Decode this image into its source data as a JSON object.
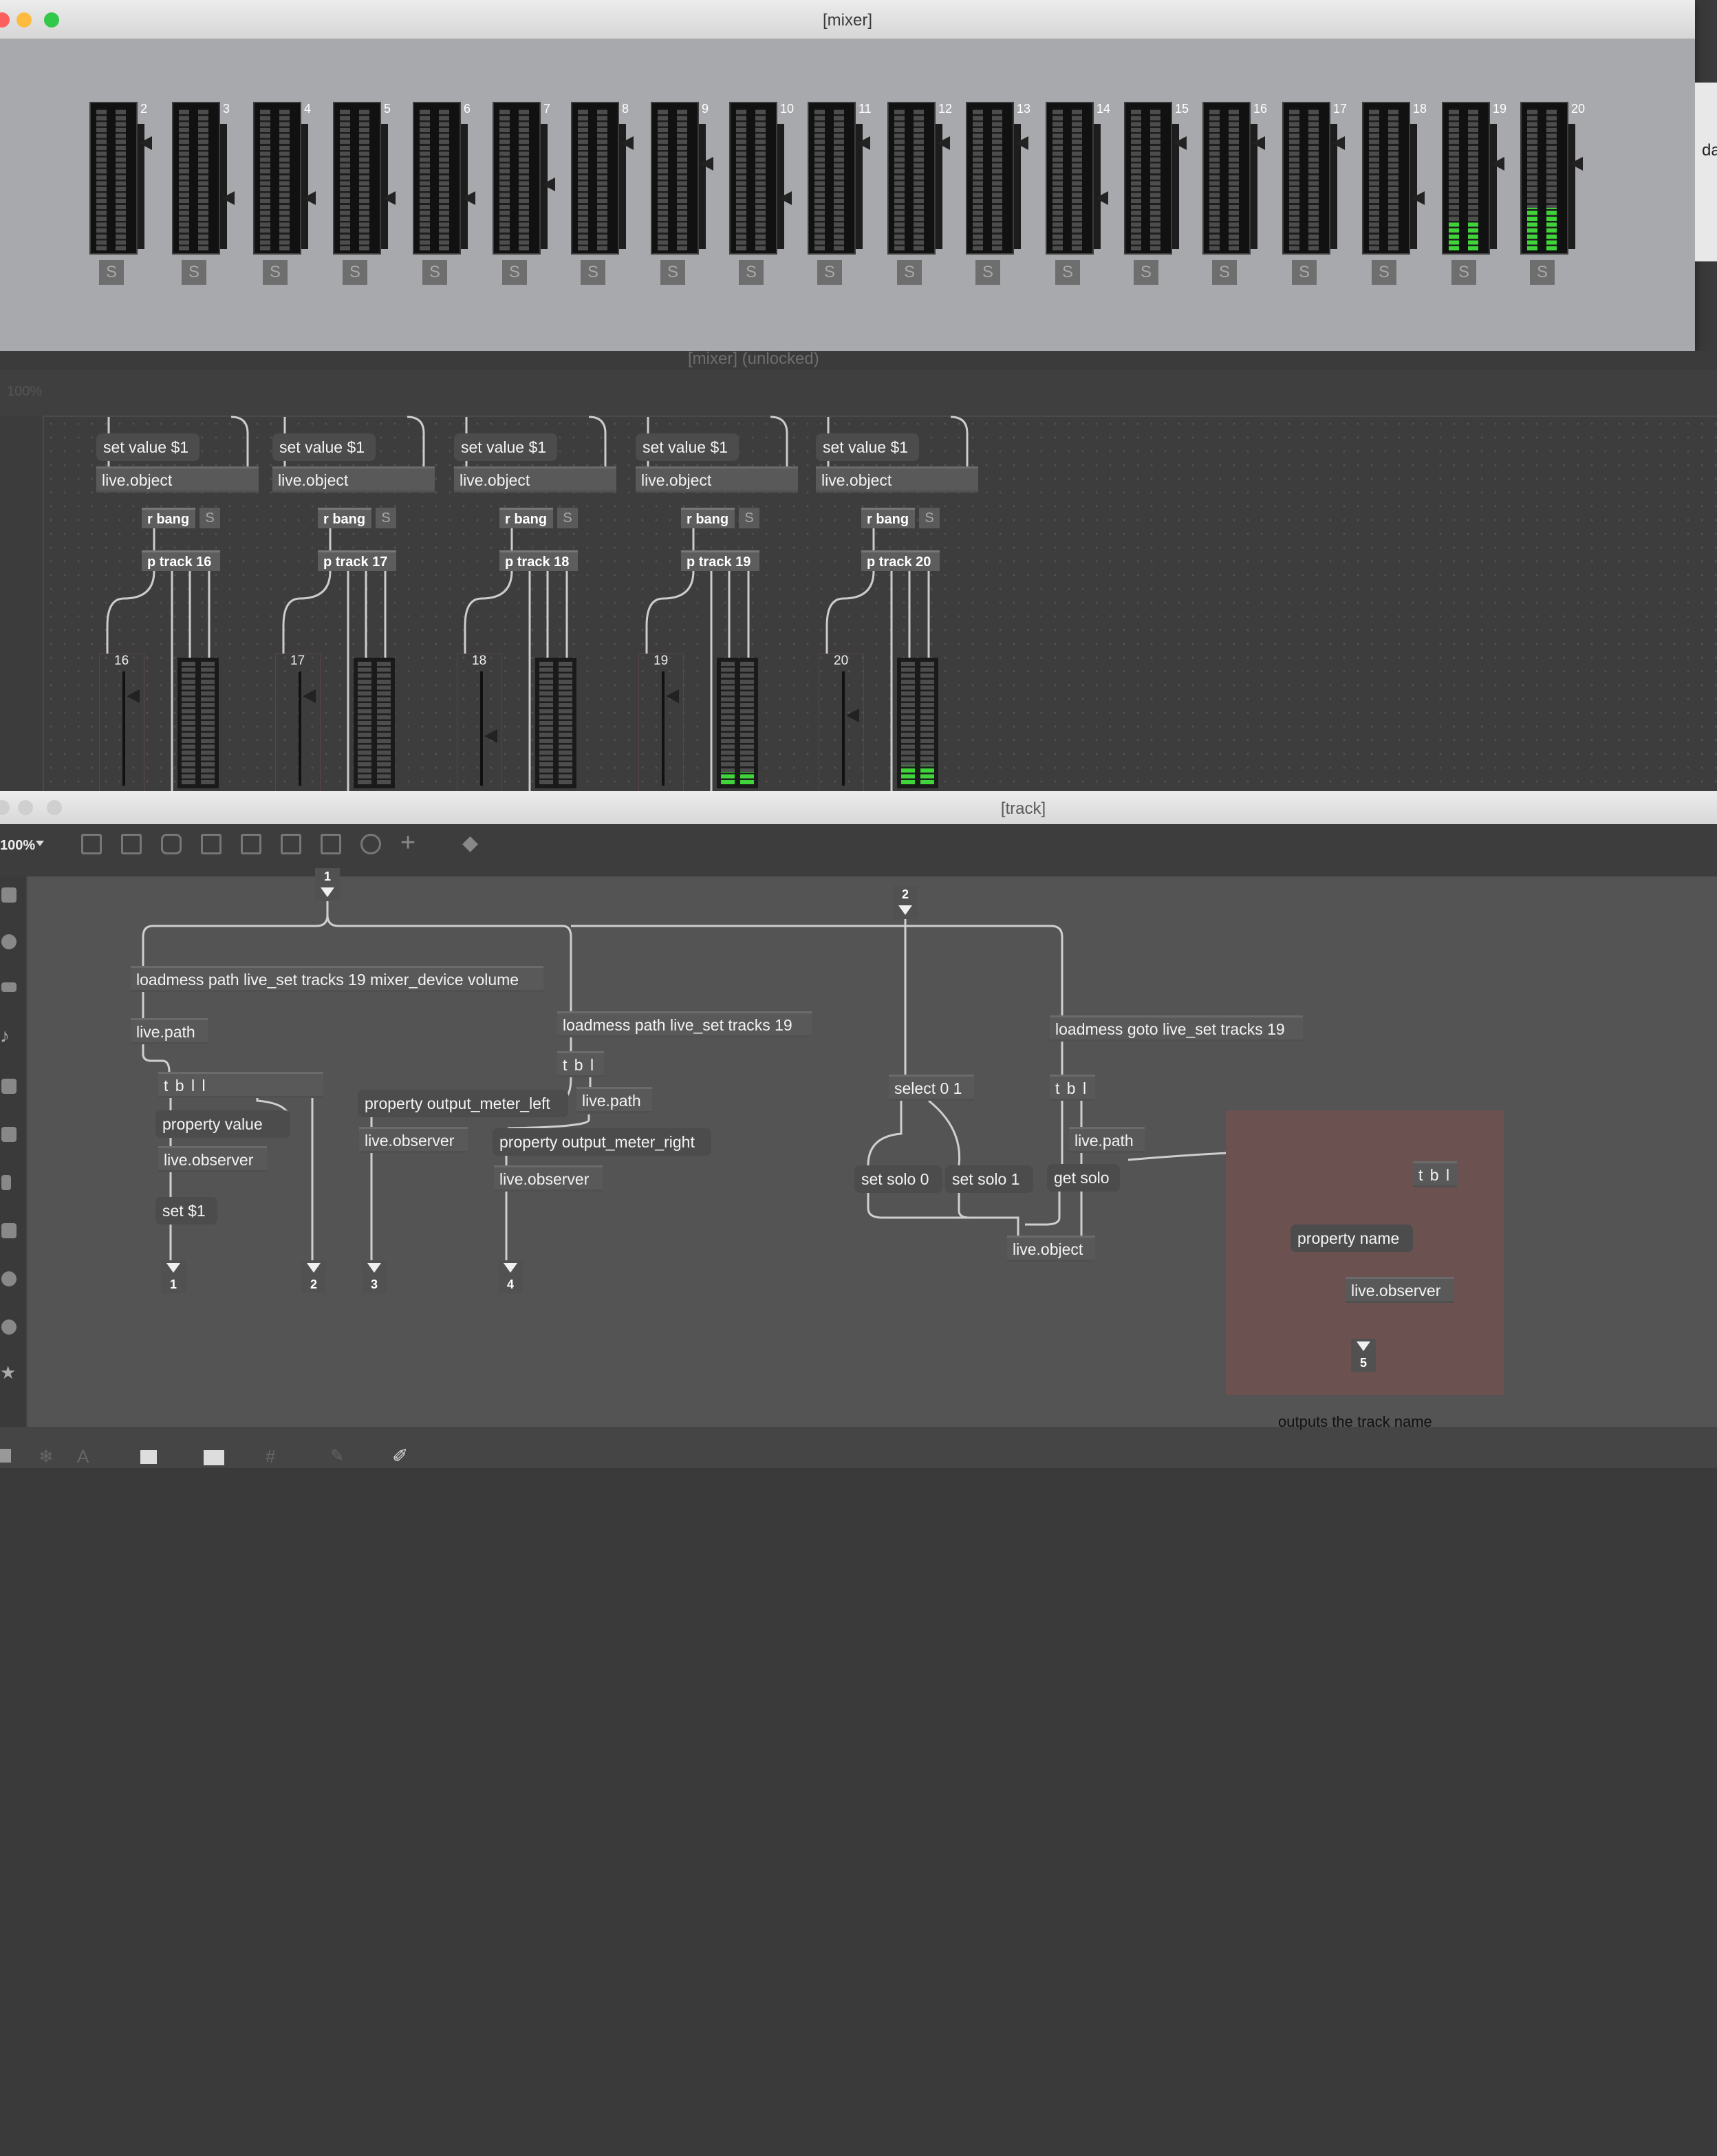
{
  "mixer_window": {
    "title": "[mixer]",
    "channels": [
      {
        "num": "2",
        "solo": "S",
        "left": 0,
        "right": 0
      },
      {
        "num": "3",
        "solo": "S",
        "left": 0,
        "right": 0
      },
      {
        "num": "4",
        "solo": "S",
        "left": 0,
        "right": 0
      },
      {
        "num": "5",
        "solo": "S",
        "left": 0,
        "right": 0
      },
      {
        "num": "6",
        "solo": "S",
        "left": 0,
        "right": 0
      },
      {
        "num": "7",
        "solo": "S",
        "left": 0,
        "right": 0
      },
      {
        "num": "8",
        "solo": "S",
        "left": 0,
        "right": 0
      },
      {
        "num": "9",
        "solo": "S",
        "left": 0,
        "right": 0
      },
      {
        "num": "10",
        "solo": "S",
        "left": 0,
        "right": 0
      },
      {
        "num": "11",
        "solo": "S",
        "left": 0,
        "right": 0
      },
      {
        "num": "12",
        "solo": "S",
        "left": 0,
        "right": 0
      },
      {
        "num": "13",
        "solo": "S",
        "left": 0,
        "right": 0
      },
      {
        "num": "14",
        "solo": "S",
        "left": 0,
        "right": 0
      },
      {
        "num": "15",
        "solo": "S",
        "left": 0,
        "right": 0
      },
      {
        "num": "16",
        "solo": "S",
        "left": 0,
        "right": 0
      },
      {
        "num": "17",
        "solo": "S",
        "left": 0,
        "right": 0
      },
      {
        "num": "18",
        "solo": "S",
        "left": 0,
        "right": 0
      },
      {
        "num": "19",
        "solo": "S",
        "left": 0.2,
        "right": 0.2
      },
      {
        "num": "20",
        "solo": "S",
        "left": 0.3,
        "right": 0.3
      }
    ]
  },
  "side_text": "da",
  "unlocked_window": {
    "title": "[mixer] (unlocked)",
    "zoom": "100%",
    "strips": [
      {
        "set_msg": "set value $1",
        "live_obj": "live.object",
        "rbang": "r bang",
        "solo": "S",
        "ptrack": "p track 16",
        "num": "16",
        "lvl": 0
      },
      {
        "set_msg": "set value $1",
        "live_obj": "live.object",
        "rbang": "r bang",
        "solo": "S",
        "ptrack": "p track 17",
        "num": "17",
        "lvl": 0
      },
      {
        "set_msg": "set value $1",
        "live_obj": "live.object",
        "rbang": "r bang",
        "solo": "S",
        "ptrack": "p track 18",
        "num": "18",
        "lvl": 0
      },
      {
        "set_msg": "set value $1",
        "live_obj": "live.object",
        "rbang": "r bang",
        "solo": "S",
        "ptrack": "p track 19",
        "num": "19",
        "lvl": 0.1
      },
      {
        "set_msg": "set value $1",
        "live_obj": "live.object",
        "rbang": "r bang",
        "solo": "S",
        "ptrack": "p track 20",
        "num": "20",
        "lvl": 0.15
      }
    ]
  },
  "track_window": {
    "title": "[track]",
    "zoom": "100%",
    "objects": {
      "inlet1": "1",
      "inlet2": "2",
      "loadmess_vol": "loadmess path live_set tracks 19 mixer_device volume",
      "live_path_1": "live.path",
      "tbll": "t b l l",
      "prop_value": "property value",
      "live_observer_1": "live.observer",
      "set_1": "set $1",
      "out1": "1",
      "out2": "2",
      "loadmess_tracks": "loadmess path live_set tracks 19",
      "tbl_1": "t b l",
      "live_path_2": "live.path",
      "prop_left": "property output_meter_left",
      "live_observer_2": "live.observer",
      "out3": "3",
      "prop_right": "property output_meter_right",
      "live_observer_3": "live.observer",
      "out4": "4",
      "select": "select 0 1",
      "set_solo_0": "set solo 0",
      "set_solo_1": "set solo 1",
      "loadmess_goto": "loadmess goto live_set tracks 19",
      "tbl_2": "t b l",
      "live_path_3": "live.path",
      "get_solo": "get solo",
      "live_object": "live.object",
      "tbl_3": "t b l",
      "prop_name": "property name",
      "live_observer_4": "live.observer",
      "out5": "5",
      "comment": "outputs the track name"
    }
  },
  "colors": {
    "meter_on": "#3fd43a",
    "panel_bg": "#a7a9ac",
    "patch_bg": "#505050",
    "highlight_panel": "#6b5150"
  }
}
